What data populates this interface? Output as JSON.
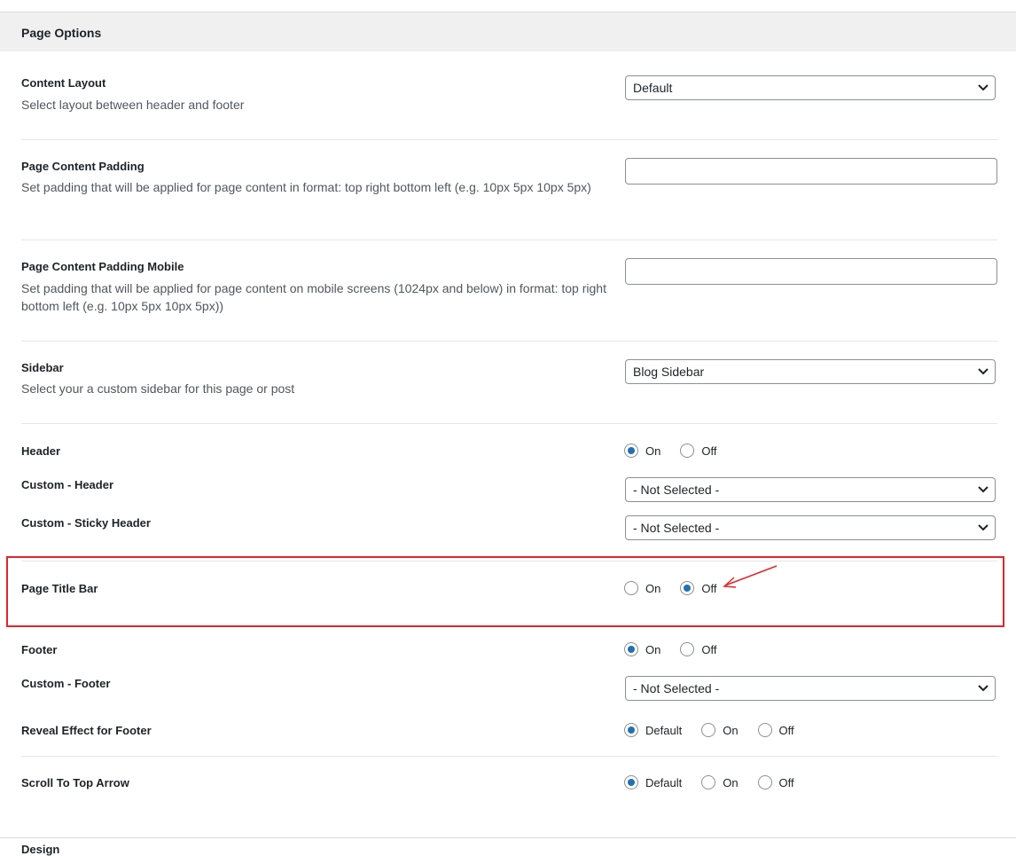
{
  "panel": {
    "title": "Page Options"
  },
  "content_layout": {
    "label": "Content Layout",
    "description": "Select layout between header and footer",
    "selected": "Default"
  },
  "padding": {
    "label": "Page Content Padding",
    "description": "Set padding that will be applied for page content in format: top right bottom left (e.g. 10px 5px 10px 5px)",
    "value": ""
  },
  "padding_mobile": {
    "label": "Page Content Padding Mobile",
    "description": "Set padding that will be applied for page content on mobile screens (1024px and below) in format: top right bottom left (e.g. 10px 5px 10px 5px))",
    "value": ""
  },
  "sidebar": {
    "label": "Sidebar",
    "description": "Select your a custom sidebar for this page or post",
    "selected": "Blog Sidebar"
  },
  "header": {
    "label": "Header",
    "options": [
      "On",
      "Off"
    ],
    "selected": "On"
  },
  "custom_header": {
    "label": "Custom - Header",
    "selected": "- Not Selected -"
  },
  "custom_sticky_header": {
    "label": "Custom - Sticky Header",
    "selected": "- Not Selected -"
  },
  "page_title_bar": {
    "label": "Page Title Bar",
    "options": [
      "On",
      "Off"
    ],
    "selected": "Off"
  },
  "footer": {
    "label": "Footer",
    "options": [
      "On",
      "Off"
    ],
    "selected": "On"
  },
  "custom_footer": {
    "label": "Custom - Footer",
    "selected": "- Not Selected -"
  },
  "reveal_footer": {
    "label": "Reveal Effect for Footer",
    "options": [
      "Default",
      "On",
      "Off"
    ],
    "selected": "Default"
  },
  "scroll_top": {
    "label": "Scroll To Top Arrow",
    "options": [
      "Default",
      "On",
      "Off"
    ],
    "selected": "Default"
  },
  "next_section": {
    "title": "Design"
  },
  "colors": {
    "accent": "#2271b1",
    "highlight": "#e0272b",
    "header_bg": "#f0f0f1"
  },
  "icons": {
    "select_arrow": "chevron-down-icon",
    "annotation": "red-arrow-icon"
  }
}
